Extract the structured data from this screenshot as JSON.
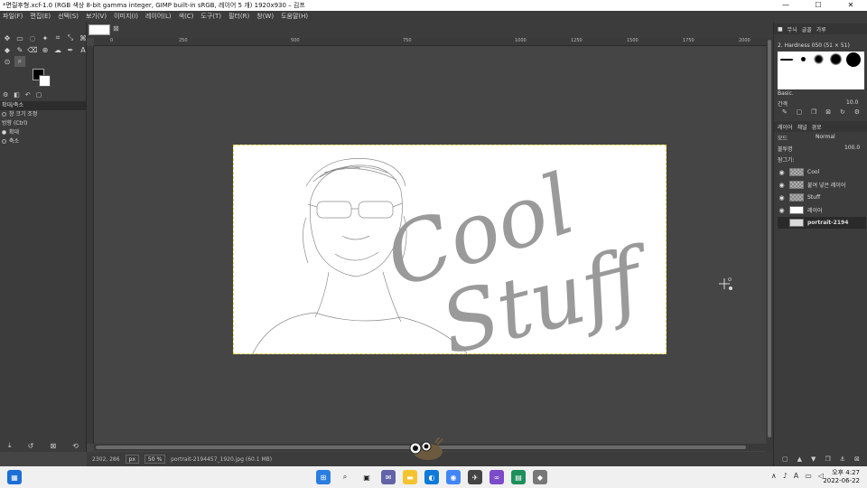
{
  "window": {
    "title": "*면릴후형.xcf-1.0 (RGB 색상 8-bit gamma integer, GIMP built-in sRGB, 레이어 5 개) 1920x930 – 김프",
    "min": "—",
    "max": "☐",
    "close": "✕"
  },
  "menu": [
    "파일(F)",
    "편집(E)",
    "선택(S)",
    "보기(V)",
    "이미지(I)",
    "레이어(L)",
    "색(C)",
    "도구(T)",
    "필터(R)",
    "창(W)",
    "도움말(H)"
  ],
  "toolbox": {
    "tabs": [
      "확대/축소"
    ],
    "options": {
      "title": "확대/축소",
      "auto_resize": "창 크기 조정",
      "direction_label": "방향 (Ctrl)",
      "zoom_in": "확대",
      "zoom_out": "축소"
    }
  },
  "ruler_marks": [
    "0",
    "250",
    "500",
    "750",
    "1000",
    "1250",
    "1500",
    "1750",
    "2000"
  ],
  "status": {
    "coords": "2302, 286",
    "unit": "px",
    "zoom": "50 %",
    "file": "portrait-2194457_1920.jpg (60.1 MB)"
  },
  "artwork": {
    "line1": "Cool",
    "line2": "Stuff"
  },
  "right_dock": {
    "tabs_top": [
      "무늬",
      "글꼴",
      "가루"
    ],
    "brush_name": "2. Hardness 050 (51 × 51)",
    "brush_set": "Basic.",
    "spacing_label": "간격",
    "spacing_value": "10.0",
    "tabs_layers": [
      "레이어",
      "채널",
      "경로"
    ],
    "mode_label": "모드",
    "mode_value": "Normal",
    "opacity_label": "불투명",
    "opacity_value": "100.0",
    "lock_label": "잠그기:",
    "layers": [
      {
        "name": "Cool",
        "visible": true,
        "thumb": "checker"
      },
      {
        "name": "붙여 넣은 레이어",
        "visible": true,
        "thumb": "checker"
      },
      {
        "name": "Stuff",
        "visible": true,
        "thumb": "checker"
      },
      {
        "name": "레이어",
        "visible": true,
        "thumb": "white"
      },
      {
        "name": "portrait-2194",
        "visible": false,
        "thumb": "photo"
      }
    ]
  },
  "taskbar": {
    "time": "오후 4:27",
    "date": "2022-06-22",
    "lang": "A"
  }
}
